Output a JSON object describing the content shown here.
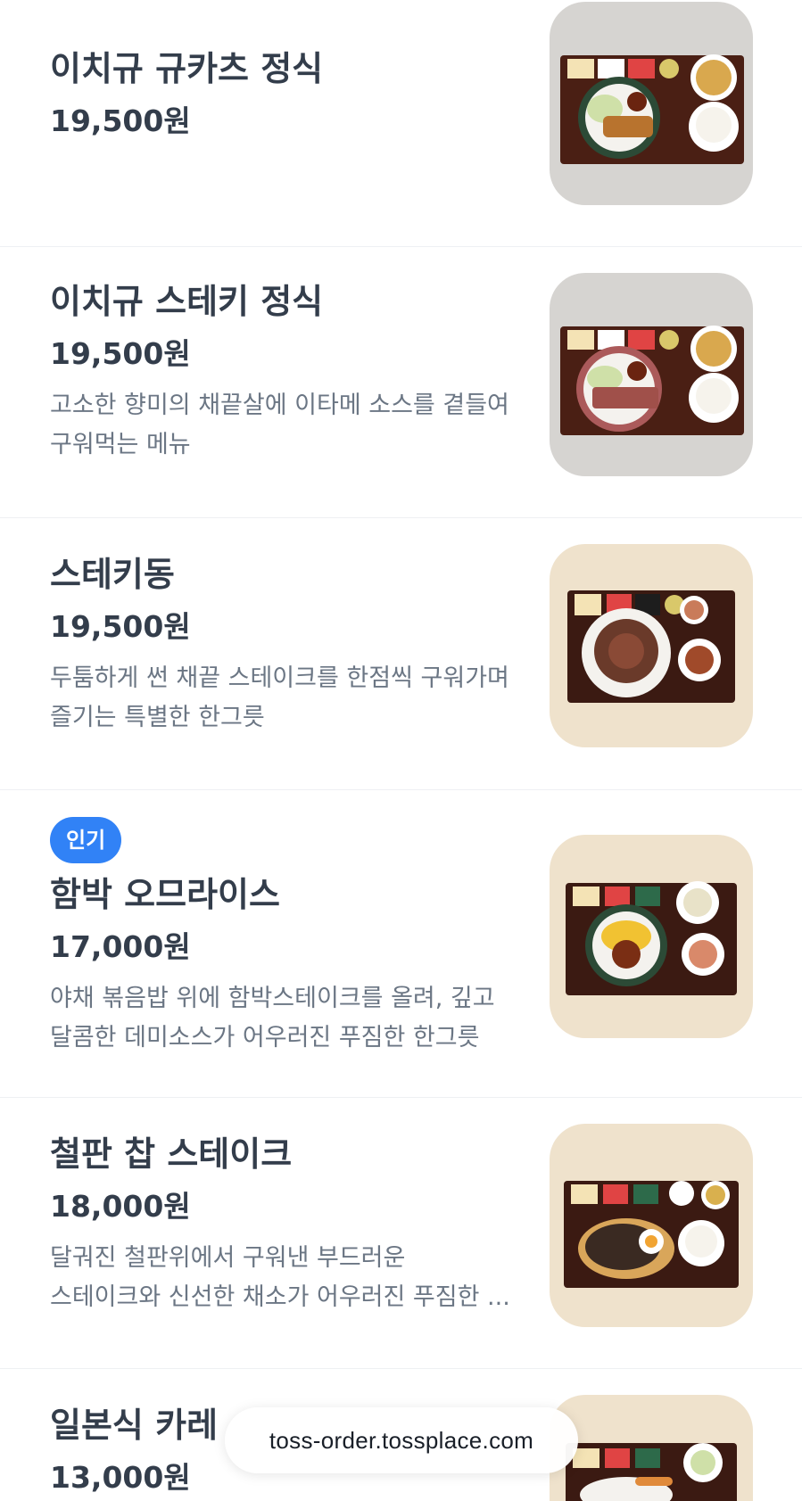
{
  "menu": {
    "items": [
      {
        "name": "이치규 규카츠 정식",
        "price": "19,500원",
        "badge": "",
        "desc": [],
        "thumb": {
          "bg": "#d6d4d1",
          "dish": "katsu",
          "tray": "#4a1f14"
        }
      },
      {
        "name": "이치규 스테키 정식",
        "price": "19,500원",
        "badge": "",
        "desc": [
          "고소한 향미의 채끝살에 이타메 소스를 곁들여",
          "구워먹는 메뉴"
        ],
        "thumb": {
          "bg": "#d6d4d1",
          "dish": "steak",
          "tray": "#4a1f14"
        }
      },
      {
        "name": "스테키동",
        "price": "19,500원",
        "badge": "",
        "desc": [
          "두툼하게 썬 채끝 스테이크를 한점씩 구워가며",
          "즐기는 특별한 한그릇"
        ],
        "thumb": {
          "bg": "#efe2cc",
          "dish": "don",
          "tray": "#3b1a12"
        }
      },
      {
        "name": "함박 오므라이스",
        "price": "17,000원",
        "badge": "인기",
        "desc": [
          "야채 볶음밥 위에 함박스테이크를 올려, 깊고",
          "달콤한 데미소스가 어우러진 푸짐한 한그릇"
        ],
        "thumb": {
          "bg": "#efe2cc",
          "dish": "omurice",
          "tray": "#3b1a12"
        }
      },
      {
        "name": "철판 찹 스테이크",
        "price": "18,000원",
        "badge": "",
        "desc": [
          "달궈진 철판위에서 구워낸 부드러운",
          "스테이크와 신선한 채소가 어우러진 푸짐한 ..."
        ],
        "thumb": {
          "bg": "#efe2cc",
          "dish": "sizzle",
          "tray": "#3b1a12"
        }
      },
      {
        "name": "일본식 카레",
        "price": "13,000원",
        "badge": "",
        "desc": [],
        "thumb": {
          "bg": "#efe2cc",
          "dish": "curry",
          "tray": "#3b1a12"
        }
      }
    ]
  },
  "browser": {
    "url": "toss-order.tossplace.com"
  },
  "colors": {
    "badge": "#3182f6",
    "title": "#333d4b",
    "description": "#6b7684",
    "divider": "#eef0f3"
  }
}
